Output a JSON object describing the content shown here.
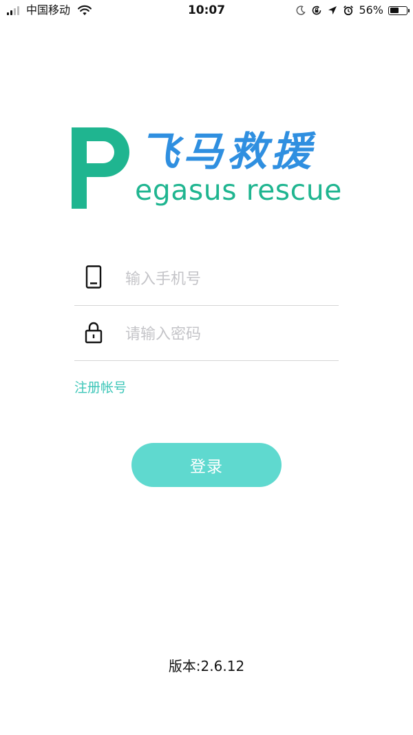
{
  "status_bar": {
    "carrier": "中国移动",
    "time": "10:07",
    "battery_percent": "56%",
    "battery_level": 0.56,
    "icons": [
      "signal-icon",
      "wifi-icon",
      "moon-icon",
      "rotation-lock-icon",
      "location-icon",
      "alarm-icon",
      "battery-icon"
    ]
  },
  "logo": {
    "letter": "P",
    "name_cn": "飞马救援",
    "name_en": "egasus rescue",
    "colors": {
      "green": "#1fb590",
      "blue": "#2f8fe0"
    }
  },
  "form": {
    "phone": {
      "value": "",
      "placeholder": "输入手机号",
      "icon": "phone-icon"
    },
    "password": {
      "value": "",
      "placeholder": "请输入密码",
      "icon": "lock-icon"
    }
  },
  "register_label": "注册帐号",
  "login_label": "登录",
  "version_label": "版本:2.6.12",
  "colors": {
    "accent": "#5fd9cf",
    "link": "#3cc6b8",
    "divider": "#d4d4d4"
  }
}
